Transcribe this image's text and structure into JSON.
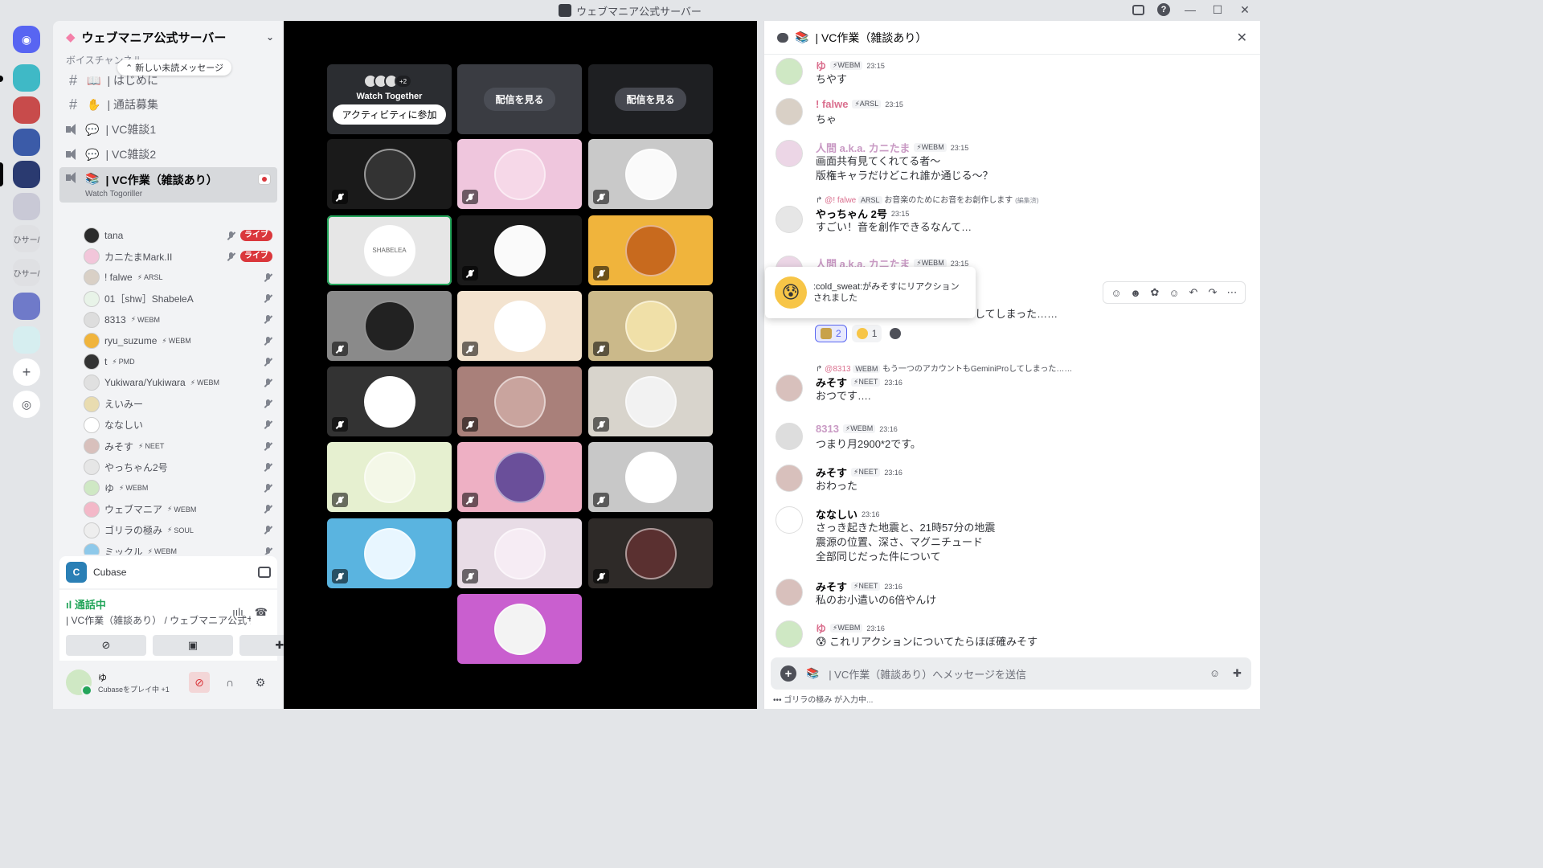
{
  "window": {
    "title": "ウェブマニア公式サーバー"
  },
  "server": {
    "name": "ウェブマニア公式サーバー",
    "category": "ボイスチャンネル",
    "unread_pill": "新しい未読メッセージ"
  },
  "channels": [
    {
      "type": "text",
      "emoji": "📖",
      "label": "| はじめに"
    },
    {
      "type": "text",
      "emoji": "✋",
      "label": "| 通話募集"
    },
    {
      "type": "voice",
      "emoji": "💬",
      "label": "| VC雑談1"
    },
    {
      "type": "voice",
      "emoji": "💬",
      "label": "| VC雑談2"
    },
    {
      "type": "voice",
      "emoji": "📚",
      "label": "| VC作業（雑談あり）",
      "sub": "Watch Togoriller"
    }
  ],
  "members": [
    {
      "name": "tana",
      "tag": "",
      "live": "ライブ",
      "color": "#2b2b2b"
    },
    {
      "name": "カニたまMark.II",
      "tag": "",
      "live": "ライブ",
      "color": "#f2c6da"
    },
    {
      "name": "! falwe",
      "tag": "ARSL",
      "live": "",
      "color": "#d9d0c6"
    },
    {
      "name": "01［shw］ShabeleA",
      "tag": "",
      "live": "",
      "color": "#e8f3e8"
    },
    {
      "name": "8313",
      "tag": "WEBM",
      "live": "",
      "color": "#dddddd"
    },
    {
      "name": "ryu_suzume",
      "tag": "WEBM",
      "live": "",
      "color": "#f0b43c"
    },
    {
      "name": "t",
      "tag": "PMD",
      "live": "",
      "color": "#333333"
    },
    {
      "name": "Yukiwara/Yukiwara",
      "tag": "WEBM",
      "live": "",
      "color": "#e0e0e0"
    },
    {
      "name": "えいみー",
      "tag": "",
      "live": "",
      "color": "#e9dcb0"
    },
    {
      "name": "ななしい",
      "tag": "",
      "live": "",
      "color": "#ffffff"
    },
    {
      "name": "みそす",
      "tag": "NEET",
      "live": "",
      "color": "#d8c0bc"
    },
    {
      "name": "やっちゃん2号",
      "tag": "",
      "live": "",
      "color": "#e6e6e6"
    },
    {
      "name": "ゆ",
      "tag": "WEBM",
      "live": "",
      "color": "#cfe8c4"
    },
    {
      "name": "ウェブマニア",
      "tag": "WEBM",
      "live": "",
      "color": "#f3b8c8"
    },
    {
      "name": "ゴリラの極み",
      "tag": "SOUL",
      "live": "",
      "color": "#eeeeee"
    },
    {
      "name": "ミックル",
      "tag": "WEBM",
      "live": "",
      "color": "#8ec9ea"
    },
    {
      "name": "人間 a.k.a. カニたま",
      "tag": "WEBM",
      "live": "",
      "color": "#ecd6e6"
    }
  ],
  "activity": {
    "name": "Cubase",
    "logo": "C"
  },
  "voice_panel": {
    "status": "通話中",
    "location": "| VC作業（雑談あり） / ウェブマニア公式サ..."
  },
  "user": {
    "name": "ゆ",
    "status": "Cubaseをプレイ中 +1"
  },
  "stage": {
    "watch_together": {
      "title": "Watch Together",
      "extra": "+2",
      "join": "アクティビティに参加"
    },
    "watch_stream": "配信を見る",
    "shabelea_text": "SHABELEA"
  },
  "chat": {
    "channel": "| VC作業（雑談あり）",
    "messages": [
      {
        "name": "ゆ",
        "name_color": "#da6f8e",
        "tag": "WEBM",
        "time": "23:15",
        "body": "ちやす",
        "av": "#cfe8c4"
      },
      {
        "name": "! falwe",
        "name_color": "#da6f8e",
        "tag": "ARSL",
        "time": "23:15",
        "body": "ちゃ",
        "av": "#d9d0c6"
      },
      {
        "name": "人間 a.k.a. カニたま",
        "name_color": "#c99ac4",
        "tag": "WEBM",
        "time": "23:15",
        "body": "画面共有見てくれてる者〜\n版権キャラだけどこれ誰か通じる〜？",
        "av": "#ecd6e6"
      },
      {
        "name": "やっちゃん 2号",
        "name_color": "#060607",
        "tag": "",
        "time": "23:15",
        "body": "すごい！音を創作できるなんて…",
        "av": "#e6e6e6",
        "reply": {
          "name": "@! falwe",
          "tag": "ARSL",
          "text": "お音楽のためにお音をお創作します",
          "edited": "(編集済)"
        }
      },
      {
        "name": "人間 a.k.a. カニたま",
        "name_color": "#c99ac4",
        "tag": "WEBM",
        "time": "23:15",
        "body": "",
        "av": "#ecd6e6",
        "tail": "してしまった……"
      },
      {
        "name": "みそす",
        "name_color": "#060607",
        "tag": "NEET",
        "time": "23:16",
        "body": "おつです….",
        "av": "#d8c0bc",
        "reply": {
          "name": "@8313",
          "tag": "WEBM",
          "text": "もう一つのアカウントもGeminiProしてしまった……",
          "edited": ""
        }
      },
      {
        "name": "8313",
        "name_color": "#c99ac4",
        "tag": "WEBM",
        "time": "23:16",
        "body": "つまり月2900*2です。",
        "av": "#dddddd"
      },
      {
        "name": "みそす",
        "name_color": "#060607",
        "tag": "NEET",
        "time": "23:16",
        "body": "おわった",
        "av": "#d8c0bc"
      },
      {
        "name": "ななしい",
        "name_color": "#060607",
        "tag": "",
        "time": "23:16",
        "body": "さっき起きた地震と、21時57分の地震\n震源の位置、深さ、マグニチュード\n全部同じだった件について",
        "av": "#ffffff"
      },
      {
        "name": "みそす",
        "name_color": "#060607",
        "tag": "NEET",
        "time": "23:16",
        "body": "私のお小遣いの6倍やんけ",
        "av": "#d8c0bc"
      },
      {
        "name": "ゆ",
        "name_color": "#da6f8e",
        "tag": "WEBM",
        "time": "23:16",
        "body": "😰 これリアクションについてたらほぼ確みそす",
        "av": "#cfe8c4"
      }
    ],
    "reaction_popup": ":cold_sweat:がみそすにリアクションされました",
    "reactions": [
      {
        "count": "2"
      },
      {
        "count": "1"
      }
    ],
    "composer_placeholder": "| VC作業（雑談あり）へメッセージを送信",
    "typing": "ゴリラの極み が入力中..."
  },
  "colors": {
    "live_red": "#da373c",
    "online_green": "#23a55a",
    "blurple": "#5865f2"
  }
}
